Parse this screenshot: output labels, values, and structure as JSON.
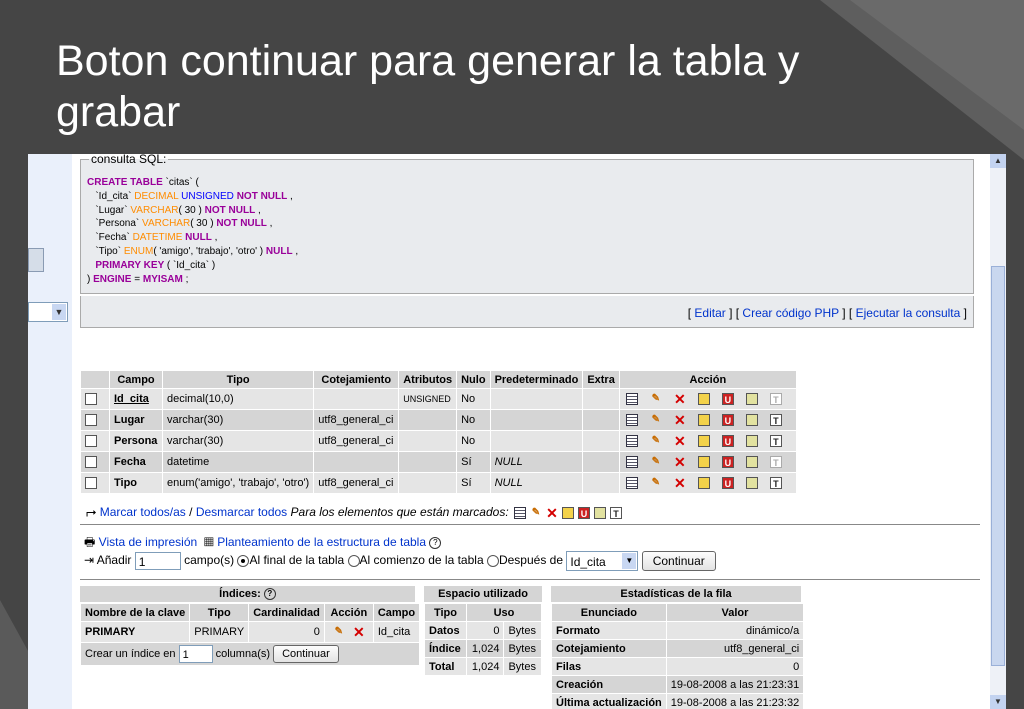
{
  "slide": {
    "title": "Boton continuar para generar la tabla y grabar"
  },
  "sql_box": {
    "legend": "consulta SQL:",
    "lines": [
      {
        "parts": [
          [
            "kw",
            "CREATE TABLE "
          ],
          [
            "id",
            "`citas`"
          ],
          [
            "pu",
            " ("
          ]
        ]
      },
      {
        "parts": [
          [
            "id",
            "   `Id_cita` "
          ],
          [
            "ty",
            "DECIMAL "
          ],
          [
            "kb",
            "UNSIGNED "
          ],
          [
            "kw",
            "NOT NULL"
          ],
          [
            "pu",
            " ,"
          ]
        ]
      },
      {
        "parts": [
          [
            "id",
            "   `Lugar` "
          ],
          [
            "ty",
            "VARCHAR"
          ],
          [
            "pu",
            "( 30 ) "
          ],
          [
            "kw",
            "NOT NULL"
          ],
          [
            "pu",
            " ,"
          ]
        ]
      },
      {
        "parts": [
          [
            "id",
            "   `Persona` "
          ],
          [
            "ty",
            "VARCHAR"
          ],
          [
            "pu",
            "( 30 ) "
          ],
          [
            "kw",
            "NOT NULL"
          ],
          [
            "pu",
            " ,"
          ]
        ]
      },
      {
        "parts": [
          [
            "id",
            "   `Fecha` "
          ],
          [
            "ty",
            "DATETIME "
          ],
          [
            "kw",
            "NULL"
          ],
          [
            "pu",
            " ,"
          ]
        ]
      },
      {
        "parts": [
          [
            "id",
            "   `Tipo` "
          ],
          [
            "ty",
            "ENUM"
          ],
          [
            "pu",
            "( 'amigo', 'trabajo', 'otro' ) "
          ],
          [
            "kw",
            "NULL"
          ],
          [
            "pu",
            " ,"
          ]
        ]
      },
      {
        "parts": [
          [
            "kw",
            "   PRIMARY KEY "
          ],
          [
            "pu",
            "( `Id_cita` )"
          ]
        ]
      },
      {
        "parts": [
          [
            "pu",
            ") "
          ],
          [
            "kw",
            "ENGINE "
          ],
          [
            "pu",
            "= "
          ],
          [
            "kw",
            "MYISAM "
          ],
          [
            "pu",
            ";"
          ]
        ]
      }
    ],
    "link_open": "[ ",
    "link_sep": " ] [ ",
    "link_close": " ]",
    "links": [
      "Editar",
      "Crear código PHP",
      "Ejecutar la consulta"
    ]
  },
  "structure": {
    "headers": [
      "Campo",
      "Tipo",
      "Cotejamiento",
      "Atributos",
      "Nulo",
      "Predeterminado",
      "Extra",
      "Acción"
    ],
    "rows": [
      {
        "campo": "Id_cita",
        "tipo": "decimal(10,0)",
        "cotejamiento": "",
        "atributos": "UNSIGNED",
        "nulo": "No",
        "predeterminado": "",
        "extra": ""
      },
      {
        "campo": "Lugar",
        "tipo": "varchar(30)",
        "cotejamiento": "utf8_general_ci",
        "atributos": "",
        "nulo": "No",
        "predeterminado": "",
        "extra": ""
      },
      {
        "campo": "Persona",
        "tipo": "varchar(30)",
        "cotejamiento": "utf8_general_ci",
        "atributos": "",
        "nulo": "No",
        "predeterminado": "",
        "extra": ""
      },
      {
        "campo": "Fecha",
        "tipo": "datetime",
        "cotejamiento": "",
        "atributos": "",
        "nulo": "Sí",
        "predeterminado": "NULL",
        "extra": ""
      },
      {
        "campo": "Tipo",
        "tipo": "enum('amigo', 'trabajo', 'otro')",
        "cotejamiento": "utf8_general_ci",
        "atributos": "",
        "nulo": "Sí",
        "predeterminado": "NULL",
        "extra": ""
      }
    ],
    "check_all": "Marcar todos/as",
    "separator": " / ",
    "uncheck_all": "Desmarcar todos",
    "with_selected": "Para los elementos que están marcados:"
  },
  "tools": {
    "print_view": "Vista de impresión",
    "propose_structure": "Planteamiento de la estructura de tabla",
    "add_label": "Añadir",
    "add_count": "1",
    "fields_label": "campo(s)",
    "opt_end": "Al final de la tabla",
    "opt_begin": "Al comienzo de la tabla",
    "opt_after": "Después de",
    "after_field": "Id_cita",
    "continue_label": "Continuar"
  },
  "indexes": {
    "caption": "Índices:",
    "headers": [
      "Nombre de la clave",
      "Tipo",
      "Cardinalidad",
      "Acción",
      "Campo"
    ],
    "rows": [
      {
        "nombre": "PRIMARY",
        "tipo": "PRIMARY",
        "cardinalidad": "0",
        "campo": "Id_cita"
      }
    ],
    "create_label": "Crear un índice en",
    "create_count": "1",
    "columns_label": "columna(s)",
    "continue_label": "Continuar"
  },
  "space": {
    "caption": "Espacio utilizado",
    "headers": [
      "Tipo",
      "Uso"
    ],
    "rows": [
      {
        "tipo": "Datos",
        "valor": "0",
        "unidad": "Bytes"
      },
      {
        "tipo": "Índice",
        "valor": "1,024",
        "unidad": "Bytes"
      },
      {
        "tipo": "Total",
        "valor": "1,024",
        "unidad": "Bytes"
      }
    ]
  },
  "row_stats": {
    "caption": "Estadísticas de la fila",
    "headers": [
      "Enunciado",
      "Valor"
    ],
    "rows": [
      {
        "enunciado": "Formato",
        "valor": "dinámico/a"
      },
      {
        "enunciado": "Cotejamiento",
        "valor": "utf8_general_ci"
      },
      {
        "enunciado": "Filas",
        "valor": "0"
      },
      {
        "enunciado": "Creación",
        "valor": "19-08-2008 a las 21:23:31"
      },
      {
        "enunciado": "Última actualización",
        "valor": "19-08-2008 a las 21:23:32"
      }
    ]
  },
  "theme": {
    "link_color": "#0033cc",
    "header_bg": "#d5d5d5",
    "row_odd": "#e5e5e5",
    "row_even": "#d5d5d5"
  }
}
